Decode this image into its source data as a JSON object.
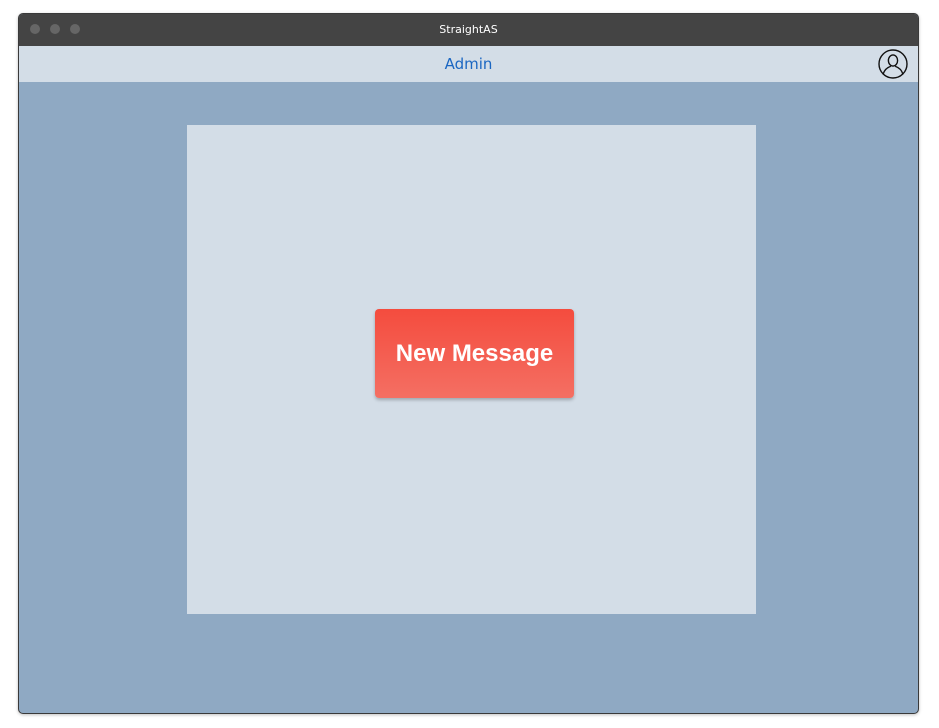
{
  "window": {
    "title": "StraightAS"
  },
  "navbar": {
    "link_label": "Admin",
    "link_color": "#1a66c2"
  },
  "header": {
    "avatar_icon": "user-profile-icon"
  },
  "main": {
    "new_message_label": "New Message",
    "button_color": "#f44c3e"
  },
  "colors": {
    "titlebar": "#444444",
    "navbar": "#d3dde7",
    "background": "#8fa9c3",
    "panel": "#d3dde7"
  }
}
